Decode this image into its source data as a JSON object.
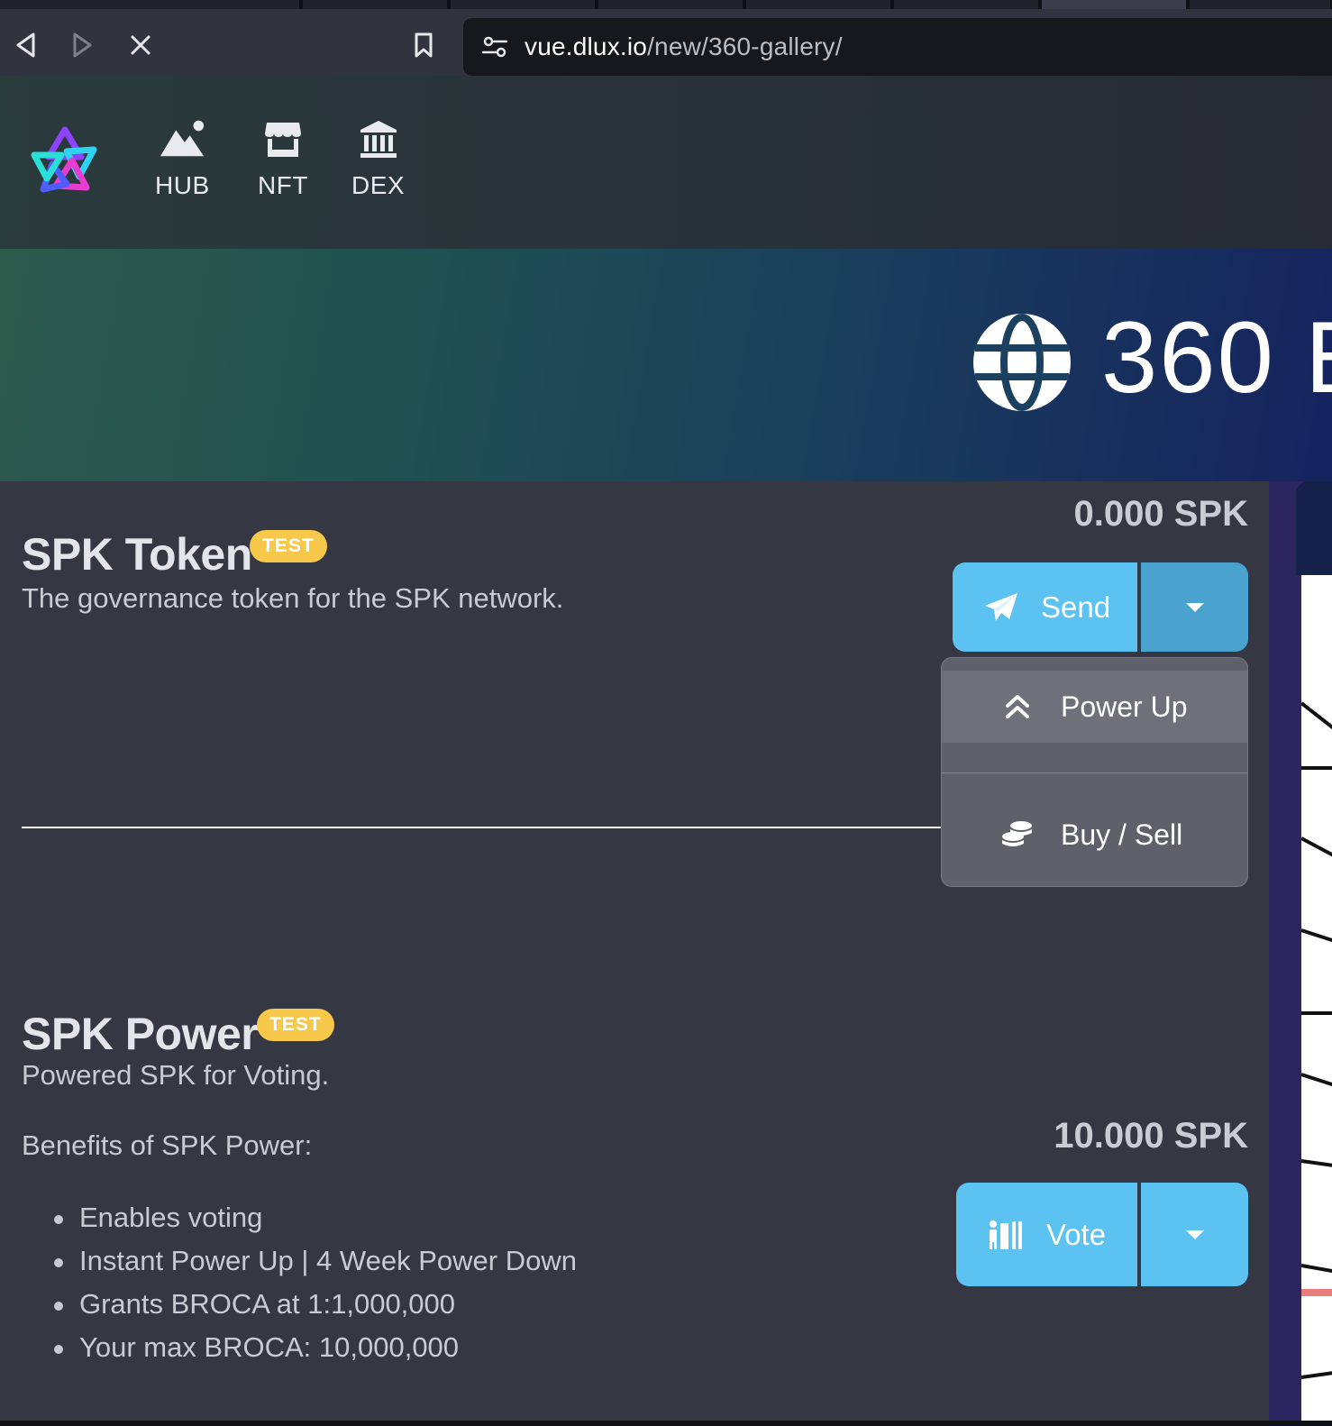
{
  "browser": {
    "url_host": "vue.dlux.io",
    "url_path": "/new/360-gallery/"
  },
  "site_nav": {
    "items": [
      {
        "label": "HUB",
        "icon": "mountain-photo-icon"
      },
      {
        "label": "NFT",
        "icon": "store-icon"
      },
      {
        "label": "DEX",
        "icon": "bank-icon"
      }
    ]
  },
  "hero": {
    "title": "360 E",
    "icon": "globe-icon"
  },
  "spk_token": {
    "title": "SPK Token",
    "badge": "TEST",
    "description": "The governance token for the SPK network.",
    "balance": "0.000 SPK",
    "primary_action": "Send",
    "menu": [
      {
        "label": "Power Up",
        "icon": "double-chevron-up-icon"
      },
      {
        "label": "Buy / Sell",
        "icon": "coins-icon"
      }
    ]
  },
  "spk_power": {
    "title": "SPK Power",
    "badge": "TEST",
    "description": "Powered SPK for Voting.",
    "balance": "10.000 SPK",
    "primary_action": "Vote",
    "benefits_title": "Benefits of SPK Power:",
    "benefits": [
      "Enables voting",
      "Instant Power Up | 4 Week Power Down",
      "Grants BROCA at 1:1,000,000",
      "Your max BROCA: 10,000,000"
    ]
  },
  "colors": {
    "accent_button": "#5cc2f2",
    "badge": "#f8c84a",
    "panel": "#353842"
  }
}
